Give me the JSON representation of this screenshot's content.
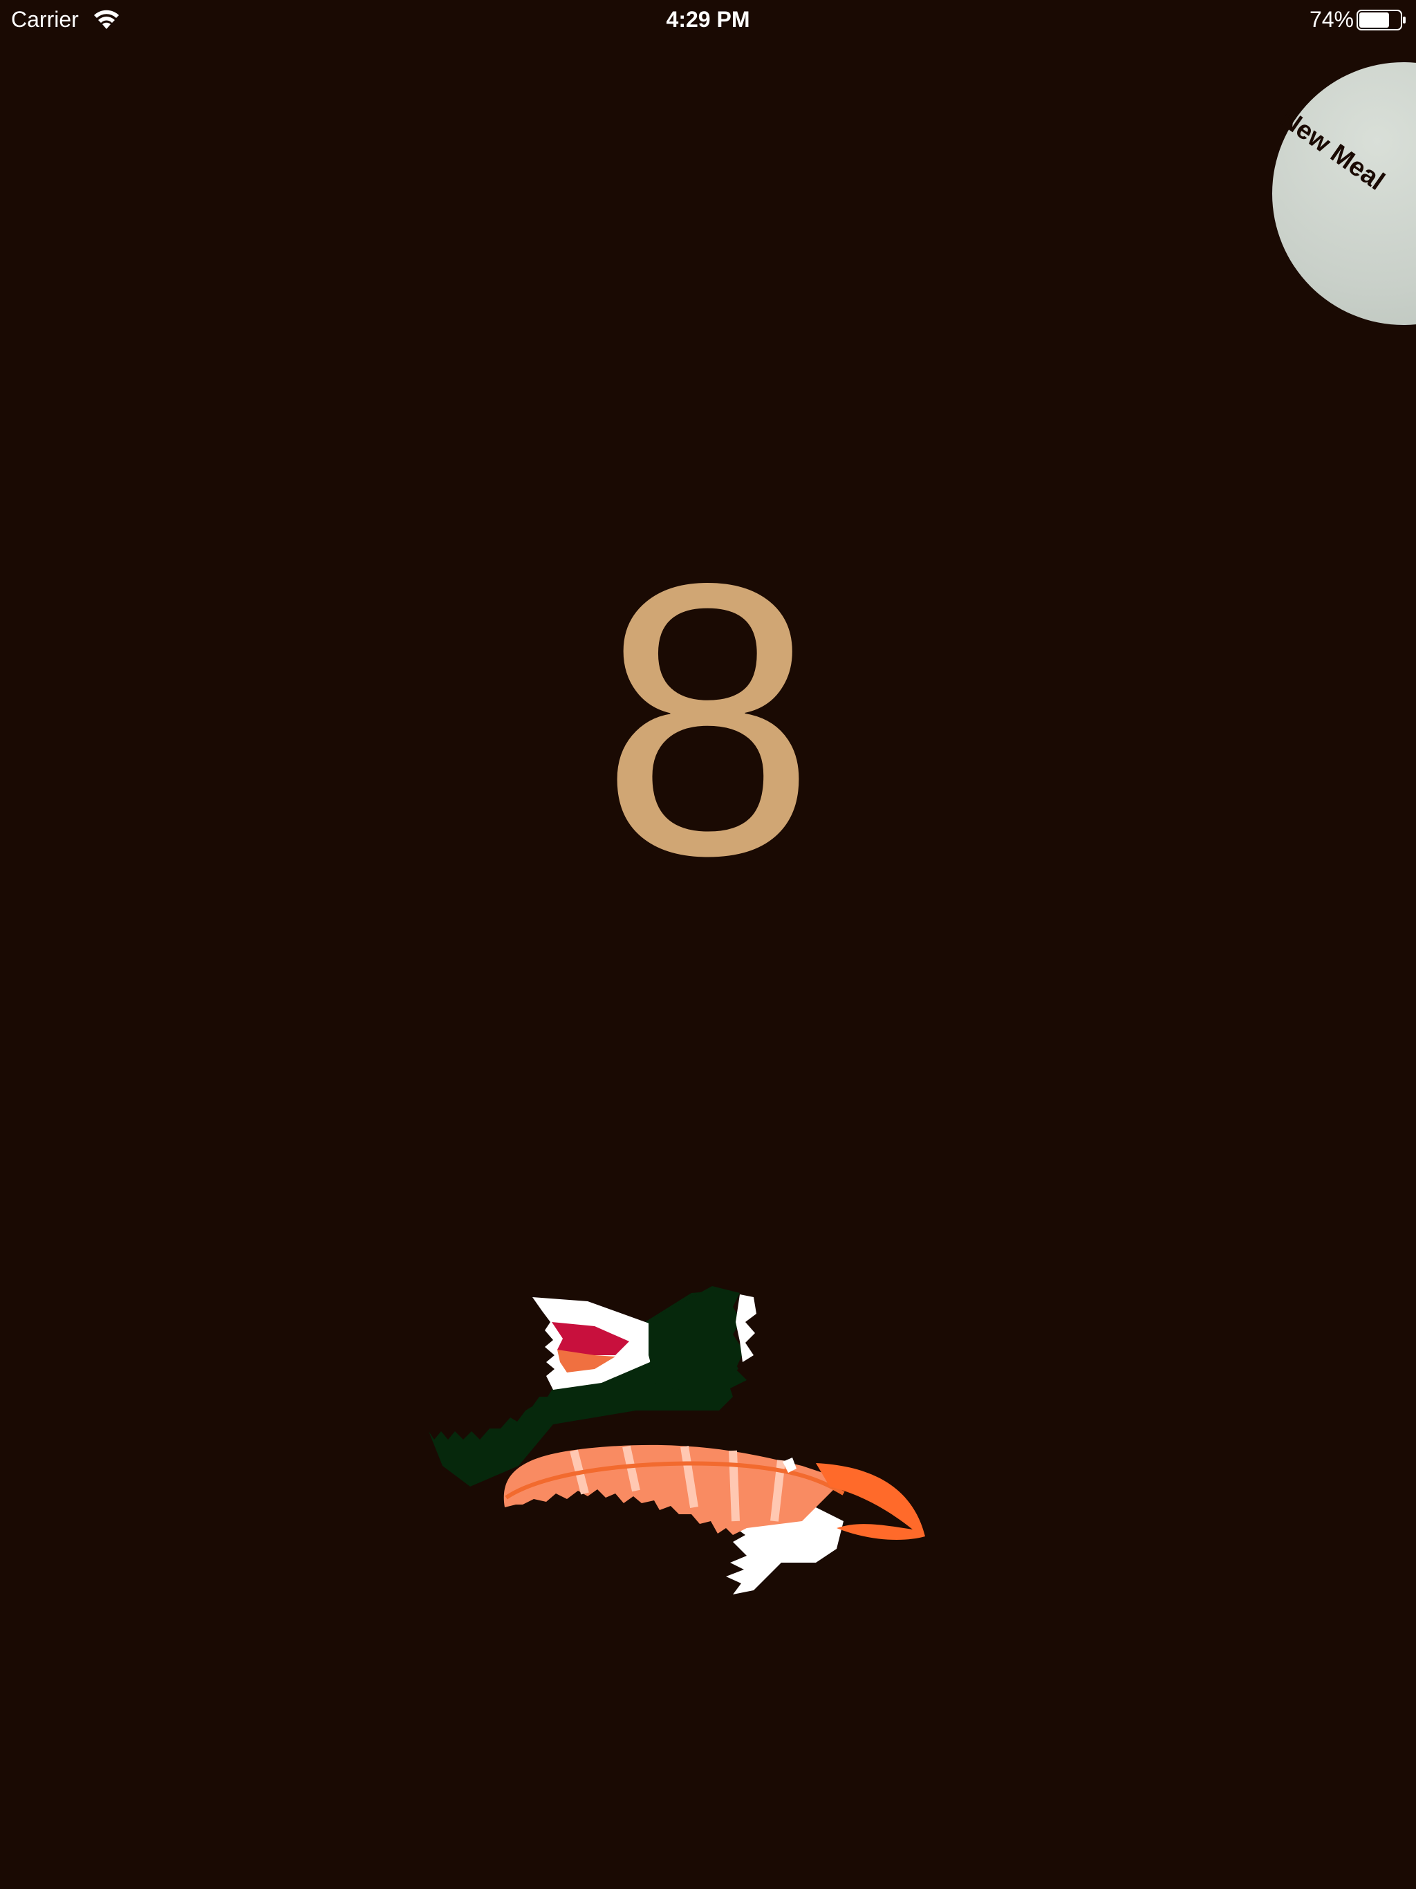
{
  "status_bar": {
    "carrier": "Carrier",
    "time": "4:29 PM",
    "battery_percent": "74%",
    "battery_level": 0.74
  },
  "new_meal_button": {
    "label": "New Meal"
  },
  "counter": {
    "value": "8"
  },
  "colors": {
    "background": "#1a0a03",
    "counter": "#d0a674",
    "button": "#c9d0c9",
    "nori": "#06280c",
    "salmon": "#f98b62",
    "tuna": "#c8103d"
  },
  "icons": {
    "wifi": "wifi-icon",
    "battery": "battery-icon",
    "sushi": "sushi-illustration"
  }
}
